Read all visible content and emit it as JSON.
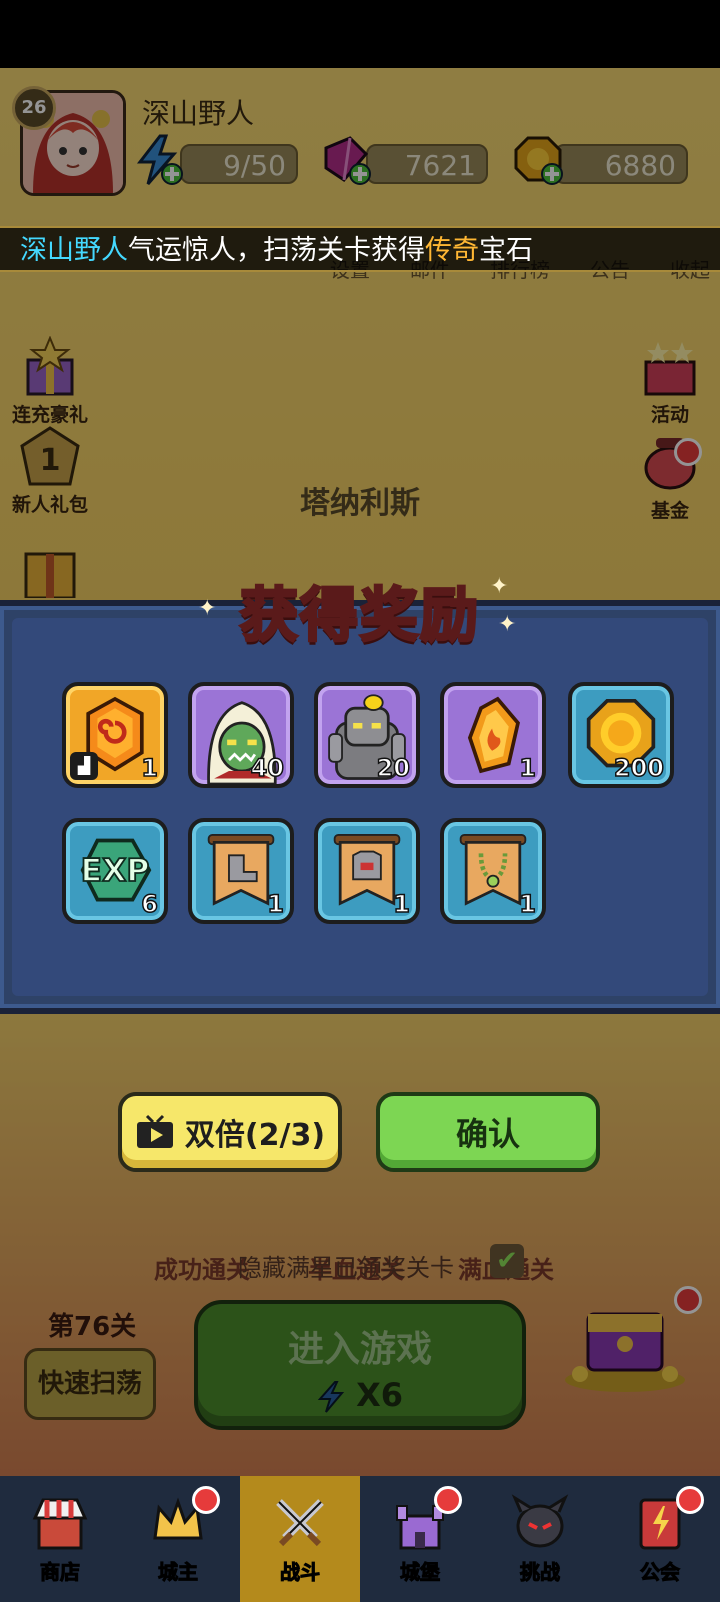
{
  "player": {
    "level": "26",
    "name": "深山野人"
  },
  "resources": {
    "energy": "9/50",
    "gems": "7621",
    "gold": "6880"
  },
  "ticker": {
    "prefix": "深山野人",
    "mid": "气运惊人，扫荡关卡获得",
    "highlight": "传奇",
    "suffix": "宝石"
  },
  "top_menu": [
    "设置",
    "邮件",
    "排行榜",
    "公告",
    "收起"
  ],
  "left_side": [
    {
      "label": "连充豪礼",
      "icon": "gift-star-icon"
    },
    {
      "label": "新人礼包",
      "icon": "badge-one-icon"
    }
  ],
  "right_side": [
    {
      "label": "活动",
      "icon": "stars-gift-icon"
    },
    {
      "label": "基金",
      "icon": "money-pig-icon"
    }
  ],
  "stage_name": "塔纳利斯",
  "reward_dialog": {
    "title": "获得奖励",
    "items": [
      {
        "icon": "gem-orange-icon",
        "qty": "1",
        "frame": "gold"
      },
      {
        "icon": "hooded-orc-hero-icon",
        "qty": "40",
        "frame": "purple"
      },
      {
        "icon": "stone-golem-hero-icon",
        "qty": "20",
        "frame": "purple"
      },
      {
        "icon": "fire-crystal-icon",
        "qty": "1",
        "frame": "purple"
      },
      {
        "icon": "gold-coin-icon",
        "qty": "200",
        "frame": "blue"
      },
      {
        "icon": "exp-icon",
        "qty": "6",
        "frame": "blue",
        "text": "EXP"
      },
      {
        "icon": "boots-scroll-icon",
        "qty": "1",
        "frame": "blue"
      },
      {
        "icon": "armor-scroll-icon",
        "qty": "1",
        "frame": "blue"
      },
      {
        "icon": "necklace-scroll-icon",
        "qty": "1",
        "frame": "blue"
      }
    ],
    "double_label": "双倍(2/3)",
    "confirm_label": "确认"
  },
  "star_conditions": [
    "成功通关",
    "半血通关",
    "满血通关"
  ],
  "hide_completed": "隐藏满星已领奖关卡",
  "stage_number": "第76关",
  "sweep_label": "快速扫荡",
  "enter_game": {
    "label": "进入游戏",
    "cost": "X6"
  },
  "tabs": [
    {
      "label": "商店",
      "icon": "shop-icon"
    },
    {
      "label": "城主",
      "icon": "crown-icon"
    },
    {
      "label": "战斗",
      "icon": "crossed-swords-icon",
      "active": true
    },
    {
      "label": "城堡",
      "icon": "castle-icon"
    },
    {
      "label": "挑战",
      "icon": "demon-mask-icon"
    },
    {
      "label": "公会",
      "icon": "guild-book-icon"
    }
  ],
  "colors": {
    "modal_bg": "#2e4267",
    "gold_frame": "#f1a627",
    "purple_frame": "#9b74d6",
    "blue_frame": "#3d9cc0",
    "confirm_green": "#7dd653",
    "double_yellow": "#f6e76a"
  }
}
